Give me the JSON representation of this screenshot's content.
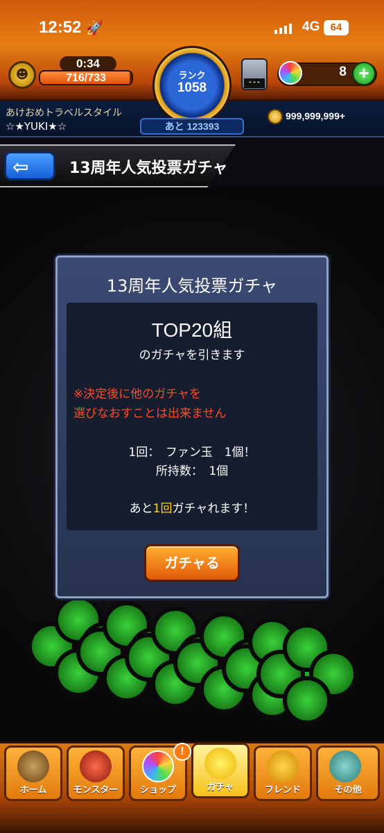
{
  "status_bar": {
    "time": "12:52",
    "network": "4G",
    "battery": "64",
    "icons": [
      "rocket-icon",
      "signal-icon"
    ]
  },
  "hud": {
    "stamina_timer": "0:34",
    "stamina": "716/733",
    "stamina_fraction": 0.977,
    "rank_label": "ランク",
    "rank": "1058",
    "rank_next": "あと 123393",
    "slot_text": "---",
    "orbs": "8",
    "event_name": "あけおめトラベルスタイル",
    "player_name": "☆★YUKI★☆",
    "coins": "999,999,999+"
  },
  "page": {
    "title": "13周年人気投票ガチャ"
  },
  "dialog": {
    "title": "13周年人気投票ガチャ",
    "gacha_name": "TOP20組",
    "subtitle": "のガチャを引きます",
    "warning_line1": "※決定後に他のガチャを",
    "warning_line2": "選びなおすことは出来ません",
    "cost": "1回：　ファン玉　1個！",
    "owned": "所持数：　1個",
    "remaining_prefix": "あと",
    "remaining_count": "1回",
    "remaining_suffix": "ガチャれます！",
    "button": "ガチャる"
  },
  "nav": {
    "items": [
      {
        "label": "ホーム",
        "icon": "home-icon"
      },
      {
        "label": "モンスター",
        "icon": "monster-icon"
      },
      {
        "label": "ショップ",
        "icon": "shop-orb-icon"
      },
      {
        "label": "ガチャ",
        "icon": "gacha-icon"
      },
      {
        "label": "フレンド",
        "icon": "friend-icon"
      },
      {
        "label": "その他",
        "icon": "other-icon"
      }
    ],
    "shop_badge": "!"
  },
  "colors": {
    "accent_orange": "#e77b12",
    "warning_red": "#ff4a2a",
    "highlight_yellow": "#ffd21a",
    "dialog_blue": "#3b4a73"
  }
}
